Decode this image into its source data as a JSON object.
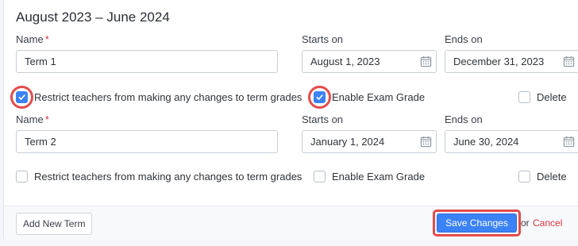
{
  "period": {
    "title": "August 2023 – June 2024"
  },
  "labels": {
    "name": "Name",
    "required_mark": "*",
    "starts_on": "Starts on",
    "ends_on": "Ends on"
  },
  "terms": [
    {
      "name": "Term 1",
      "starts_on": "August 1, 2023",
      "ends_on": "December 31, 2023",
      "restrict_label": "Restrict teachers from making any changes to term grades",
      "restrict_checked": true,
      "exam_label": "Enable Exam Grade",
      "exam_checked": true,
      "delete_label": "Delete",
      "delete_checked": false
    },
    {
      "name": "Term 2",
      "starts_on": "January 1, 2024",
      "ends_on": "June 30, 2024",
      "restrict_label": "Restrict teachers from making any changes to term grades",
      "restrict_checked": false,
      "exam_label": "Enable Exam Grade",
      "exam_checked": false,
      "delete_label": "Delete",
      "delete_checked": false
    }
  ],
  "footer": {
    "add_term_label": "Add New Term",
    "save_label": "Save Changes",
    "or_text": "or",
    "cancel_label": "Cancel"
  },
  "colors": {
    "accent": "#3b82f6",
    "highlight_ring": "#e34c4c",
    "danger": "#d9363e"
  },
  "icons": {
    "date_picker": "calendar-icon",
    "checked": "checkmark-icon"
  }
}
